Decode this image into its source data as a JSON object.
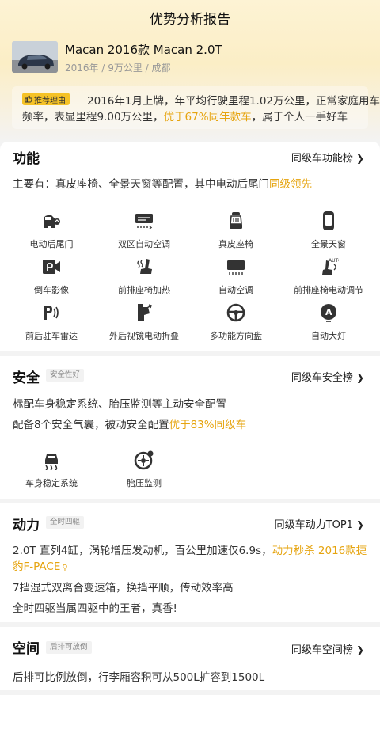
{
  "header": {
    "title": "优势分析报告"
  },
  "car": {
    "name": "Macan 2016款 Macan 2.0T",
    "meta": "2016年 / 9万公里 / 成都"
  },
  "reason": {
    "badge": "推荐理由",
    "line1": "2016年1月上牌，年平均行驶里程1.02万公里，正常家庭用车",
    "line2_a": "频率，表显里程9.00万公里，",
    "line2_hl": "优于67%同年款车",
    "line2_b": "，属于个人一手好车"
  },
  "function": {
    "title": "功能",
    "link": "同级车功能榜",
    "desc_a": "主要有：真皮座椅、全景天窗等配置，其中电动后尾门",
    "desc_hl": "同级领先",
    "features": [
      {
        "label": "电动后尾门",
        "icon": "power-tailgate-icon"
      },
      {
        "label": "双区自动空调",
        "icon": "dual-zone-ac-icon"
      },
      {
        "label": "真皮座椅",
        "icon": "leather-seat-icon"
      },
      {
        "label": "全景天窗",
        "icon": "panoramic-sunroof-icon"
      },
      {
        "label": "倒车影像",
        "icon": "reverse-camera-icon"
      },
      {
        "label": "前排座椅加热",
        "icon": "seat-heating-icon"
      },
      {
        "label": "自动空调",
        "icon": "auto-ac-icon"
      },
      {
        "label": "前排座椅电动调节",
        "icon": "seat-power-adjust-icon"
      },
      {
        "label": "前后驻车雷达",
        "icon": "parking-radar-icon"
      },
      {
        "label": "外后视镜电动折叠",
        "icon": "mirror-fold-icon"
      },
      {
        "label": "多功能方向盘",
        "icon": "steering-wheel-icon"
      },
      {
        "label": "自动大灯",
        "icon": "auto-headlight-icon"
      }
    ]
  },
  "safety": {
    "title": "安全",
    "tag": "安全性好",
    "link": "同级车安全榜",
    "line1": "标配车身稳定系统、胎压监测等主动安全配置",
    "line2_a": "配备8个安全气囊，被动安全配置",
    "line2_hl": "优于83%同级车",
    "features": [
      {
        "label": "车身稳定系统",
        "icon": "stability-control-icon"
      },
      {
        "label": "胎压监测",
        "icon": "tire-pressure-icon"
      }
    ]
  },
  "power": {
    "title": "动力",
    "tag": "全时四驱",
    "link": "同级车动力TOP1",
    "line1_a": "2.0T 直列4缸，涡轮增压发动机，百公里加速仅6.9s，",
    "line1_hl": "动力秒杀 2016款捷",
    "line1b_hl": "豹F-PACE",
    "line2": "7挡湿式双离合变速箱，换挡平顺，传动效率高",
    "line3": "全时四驱当属四驱中的王者，真香!"
  },
  "space": {
    "title": "空间",
    "tag": "后排可放倒",
    "link": "同级车空间榜",
    "line1": "后排可比例放倒，行李厢容积可从500L扩容到1500L"
  },
  "colors": {
    "accent": "#e6a40f",
    "badge": "#f5c226"
  }
}
